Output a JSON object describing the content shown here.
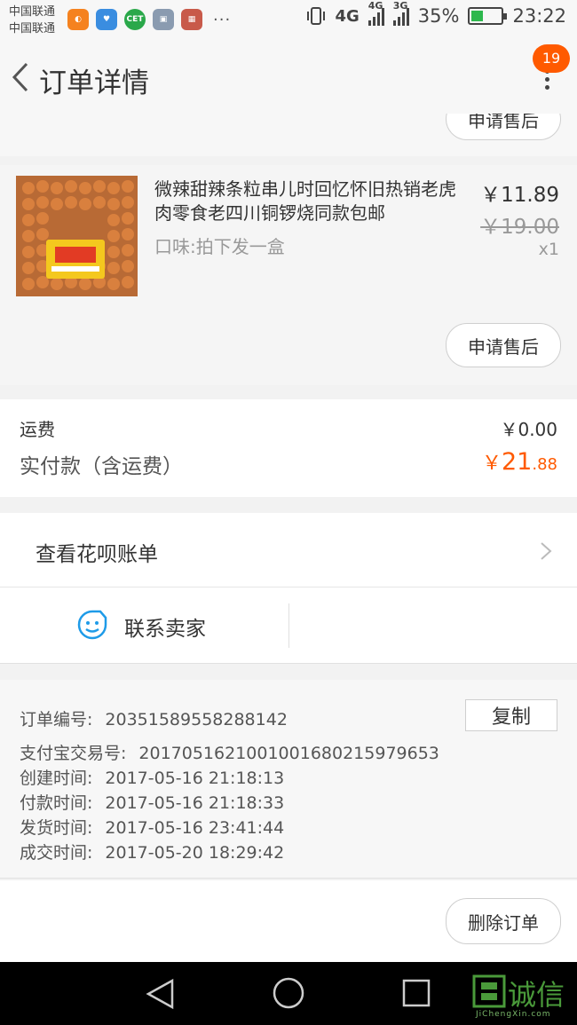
{
  "status_bar": {
    "carrier_1": "中国联通",
    "carrier_2": "中国联通",
    "net_1": "4G",
    "net_2": "4G",
    "net_3": "3G",
    "battery": "35%",
    "time": "23:22",
    "app_cet": "CET",
    "dots": "···"
  },
  "header": {
    "title": "订单详情",
    "badge": "19"
  },
  "partial": {
    "after_sale": "申请售后"
  },
  "product": {
    "name": "微辣甜辣条粒串儿时回忆怀旧热销老虎肉零食老四川铜锣烧同款包邮",
    "spec": "口味:拍下发一盒",
    "price": "￥11.89",
    "original_price": "￥19.00",
    "quantity": "x1",
    "after_sale": "申请售后"
  },
  "fees": {
    "shipping_label": "运费",
    "shipping_value": "￥0.00",
    "paid_label": "实付款（含运费）",
    "paid_currency": "￥",
    "paid_int": "21",
    "paid_dec": ".88"
  },
  "huabei": {
    "label": "查看花呗账单"
  },
  "contact": {
    "label": "联系卖家"
  },
  "info": {
    "copy_label": "复制",
    "rows": [
      {
        "k": "订单编号:",
        "v": "20351589558288142"
      },
      {
        "k": "支付宝交易号:",
        "v": "2017051621001001680215979653"
      },
      {
        "k": "创建时间:",
        "v": "2017-05-16 21:18:13"
      },
      {
        "k": "付款时间:",
        "v": "2017-05-16 21:18:33"
      },
      {
        "k": "发货时间:",
        "v": "2017-05-16 23:41:44"
      },
      {
        "k": "成交时间:",
        "v": "2017-05-20 18:29:42"
      }
    ]
  },
  "actions": {
    "delete_label": "删除订单"
  },
  "watermark": {
    "text": "诚信",
    "sub": "JiChengXin.com"
  },
  "colors": {
    "accent": "#ff5a00"
  },
  "battery_level": 0.35
}
